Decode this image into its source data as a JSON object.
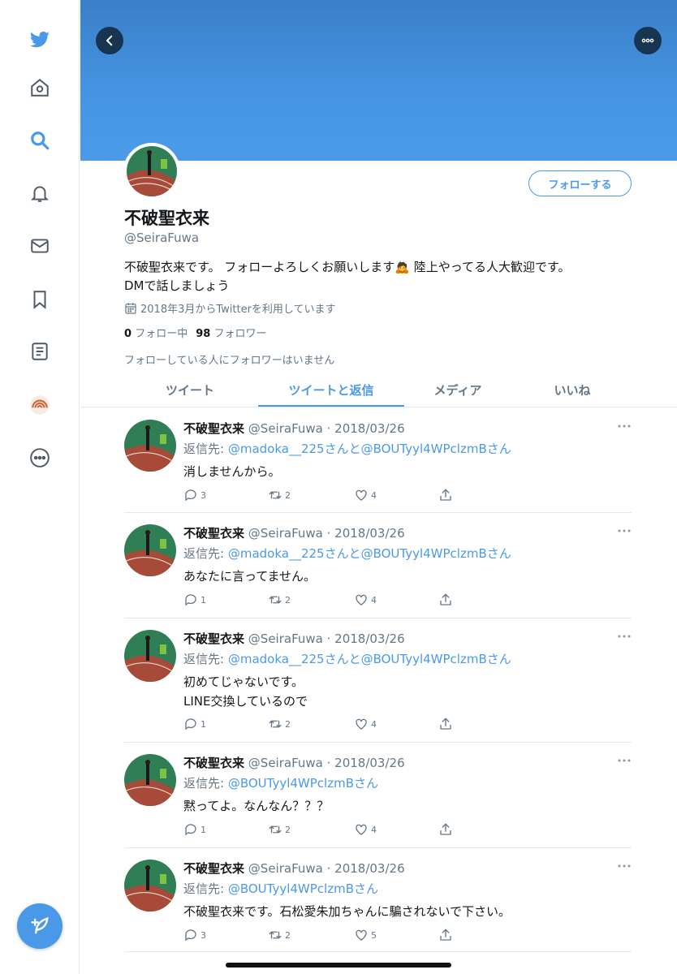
{
  "colors": {
    "accent": "#4a99e9",
    "banner": "#4695e3",
    "muted": "#657786",
    "border": "#e1e8ed"
  },
  "sidebar": {
    "items": [
      {
        "name": "twitter-logo-icon"
      },
      {
        "name": "home-icon"
      },
      {
        "name": "search-icon"
      },
      {
        "name": "notifications-bell-icon"
      },
      {
        "name": "messages-envelope-icon"
      },
      {
        "name": "bookmark-icon"
      },
      {
        "name": "lists-icon"
      },
      {
        "name": "profile-avatar-icon"
      },
      {
        "name": "more-dots-icon"
      }
    ],
    "compose": "compose-tweet-icon"
  },
  "profile": {
    "display_name": "不破聖衣来",
    "handle": "@SeiraFuwa",
    "bio_line1": "不破聖衣来です。 フォローよろしくお願いします🙇 陸上やってる人大歓迎です。",
    "bio_line2": "DMで話しましょう",
    "joined": "2018年3月からTwitterを利用しています",
    "following_count": "0",
    "following_label": "フォロー中",
    "followers_count": "98",
    "followers_label": "フォロワー",
    "no_known_followers": "フォローしている人にフォロワーはいません",
    "follow_button": "フォローする"
  },
  "tabs": [
    {
      "label": "ツイート",
      "active": false
    },
    {
      "label": "ツイートと返信",
      "active": true
    },
    {
      "label": "メディア",
      "active": false
    },
    {
      "label": "いいね",
      "active": false
    }
  ],
  "tweets": [
    {
      "name": "不破聖衣来",
      "meta": "@SeiraFuwa · 2018/03/26",
      "reply_prefix": "返信先: ",
      "reply_to": "@madoka__225さんと@BOUTyyl4WPclzmBさん",
      "text": [
        "消しませんから。"
      ],
      "replies": "3",
      "retweets": "2",
      "likes": "4"
    },
    {
      "name": "不破聖衣来",
      "meta": "@SeiraFuwa · 2018/03/26",
      "reply_prefix": "返信先: ",
      "reply_to": "@madoka__225さんと@BOUTyyl4WPclzmBさん",
      "text": [
        "あなたに言ってません。"
      ],
      "replies": "1",
      "retweets": "2",
      "likes": "4"
    },
    {
      "name": "不破聖衣来",
      "meta": "@SeiraFuwa · 2018/03/26",
      "reply_prefix": "返信先: ",
      "reply_to": "@madoka__225さんと@BOUTyyl4WPclzmBさん",
      "text": [
        "初めてじゃないです。",
        "LINE交換しているので"
      ],
      "replies": "1",
      "retweets": "2",
      "likes": "4"
    },
    {
      "name": "不破聖衣来",
      "meta": "@SeiraFuwa · 2018/03/26",
      "reply_prefix": "返信先: ",
      "reply_to": "@BOUTyyl4WPclzmBさん",
      "text": [
        "黙ってよ。なんなん？？？"
      ],
      "replies": "1",
      "retweets": "2",
      "likes": "4"
    },
    {
      "name": "不破聖衣来",
      "meta": "@SeiraFuwa · 2018/03/26",
      "reply_prefix": "返信先: ",
      "reply_to": "@BOUTyyl4WPclzmBさん",
      "text": [
        "不破聖衣来です。石松愛朱加ちゃんに騙されないで下さい。"
      ],
      "replies": "3",
      "retweets": "2",
      "likes": "5"
    }
  ]
}
